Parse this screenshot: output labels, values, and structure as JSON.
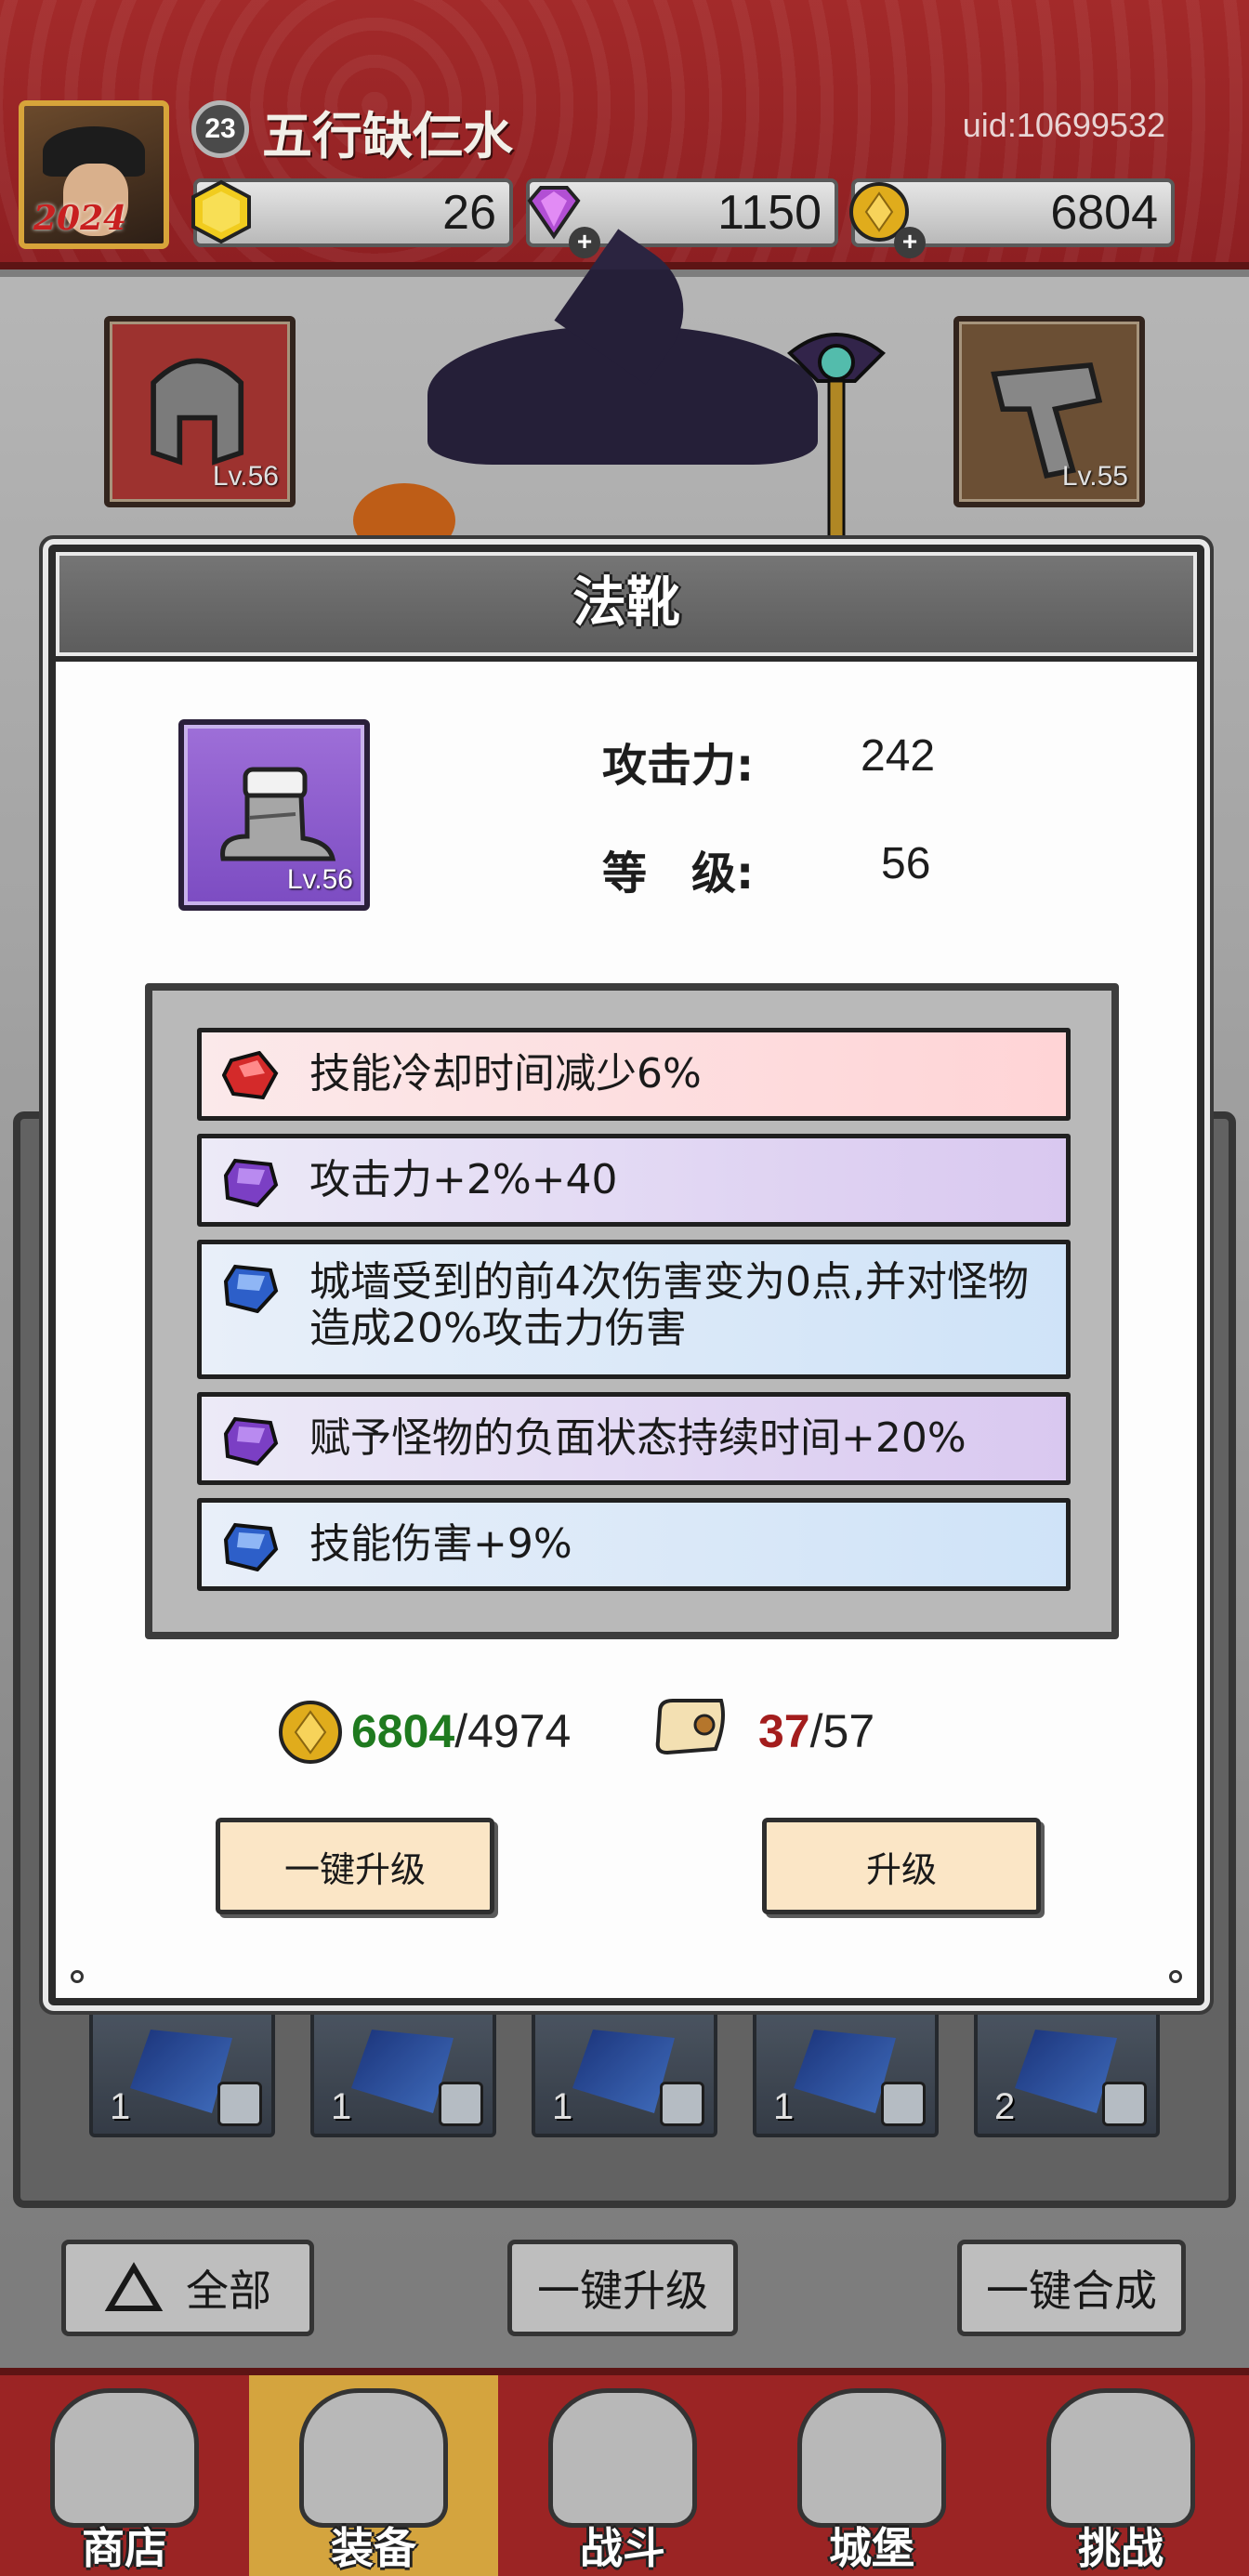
{
  "header": {
    "player_name": "五行缺仨水",
    "level": "23",
    "uid": "uid:10699532",
    "avatar_year": "2024",
    "currencies": [
      {
        "name": "gold-gem",
        "value": "26"
      },
      {
        "name": "diamond",
        "value": "1150"
      },
      {
        "name": "coin",
        "value": "6804"
      }
    ]
  },
  "equipment_slots": [
    {
      "name": "helmet",
      "level": "Lv.56"
    },
    {
      "name": "pants",
      "level": "Lv.55"
    }
  ],
  "dialog": {
    "title": "法靴",
    "item_level": "Lv.56",
    "stats": [
      {
        "label": "攻击力:",
        "value": "242"
      },
      {
        "label": "等　级:",
        "value": "56"
      }
    ],
    "affixes": [
      {
        "color": "red",
        "text": "技能冷却时间减少6%"
      },
      {
        "color": "purple",
        "text": "攻击力+2%+40"
      },
      {
        "color": "blue",
        "text": "城墙受到的前4次伤害变为0点,并对怪物造成20%攻击力伤害"
      },
      {
        "color": "purple",
        "text": "赋予怪物的负面状态持续时间+20%"
      },
      {
        "color": "blue",
        "text": "技能伤害+9%"
      }
    ],
    "cost": {
      "coin_have": "6804",
      "coin_need": "/4974",
      "scroll_have": "37",
      "scroll_need": "/57"
    },
    "buttons": {
      "one_click_upgrade": "一键升级",
      "upgrade": "升级"
    }
  },
  "inventory": {
    "gem_counts": [
      "1",
      "1",
      "1",
      "1",
      "2"
    ]
  },
  "bottom_bar": {
    "filter_all": "全部",
    "one_click_upgrade": "一键升级",
    "one_click_merge": "一键合成"
  },
  "nav": [
    {
      "label": "商店",
      "active": false
    },
    {
      "label": "装备",
      "active": true
    },
    {
      "label": "战斗",
      "active": false
    },
    {
      "label": "城堡",
      "active": false
    },
    {
      "label": "挑战",
      "active": false
    }
  ],
  "colors": {
    "header_red": "#9b2424",
    "affix_red": "#ffd4d6",
    "affix_purple": "#d9c8f0",
    "affix_blue": "#cfe3f8",
    "coin_have_green": "#1f7a1f",
    "scroll_have_red": "#a31d1d",
    "button_cream": "#fbe6c6"
  }
}
